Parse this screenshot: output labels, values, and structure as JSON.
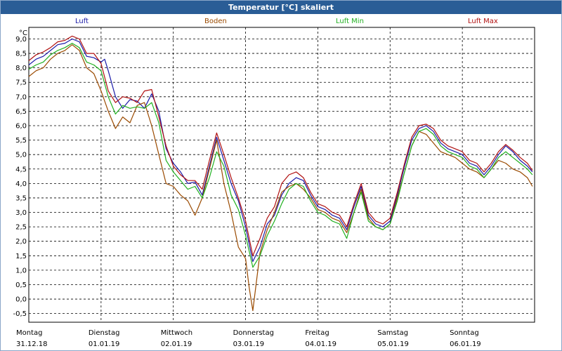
{
  "window": {
    "title": "Temperatur [°C] skaliert"
  },
  "chart_data": {
    "type": "line",
    "title": "Temperatur [°C] skaliert",
    "ylabel": "°C",
    "ylim": [
      -0.8,
      9.4
    ],
    "xlim": [
      0,
      7
    ],
    "grid": true,
    "legend_position": "top",
    "yticks": [
      9.0,
      8.5,
      8.0,
      7.5,
      7.0,
      6.5,
      6.0,
      5.5,
      5.0,
      4.5,
      4.0,
      3.5,
      3.0,
      2.5,
      2.0,
      1.5,
      1.0,
      0.5,
      0.0,
      -0.5
    ],
    "ytick_labels": [
      "9,0",
      "8,5",
      "8,0",
      "7,5",
      "7,0",
      "6,5",
      "6,0",
      "5,5",
      "5,0",
      "4,5",
      "4,0",
      "3,5",
      "3,0",
      "2,5",
      "2,0",
      "1,5",
      "1,0",
      "0,5",
      "0,0",
      "-0,5"
    ],
    "xticks": [
      {
        "day": "Montag",
        "date": "31.12.18"
      },
      {
        "day": "Dienstag",
        "date": "01.01.19"
      },
      {
        "day": "Mittwoch",
        "date": "02.01.19"
      },
      {
        "day": "Donnerstag",
        "date": "03.01.19"
      },
      {
        "day": "Freitag",
        "date": "04.01.19"
      },
      {
        "day": "Samstag",
        "date": "05.01.19"
      },
      {
        "day": "Sonntag",
        "date": "06.01.19"
      }
    ],
    "series": [
      {
        "name": "Luft",
        "color": "#1a1aa8",
        "x": [
          0,
          0.1,
          0.2,
          0.3,
          0.4,
          0.5,
          0.6,
          0.7,
          0.8,
          0.9,
          1.0,
          1.05,
          1.1,
          1.2,
          1.3,
          1.4,
          1.5,
          1.6,
          1.7,
          1.8,
          1.9,
          2.0,
          2.1,
          2.2,
          2.3,
          2.4,
          2.5,
          2.6,
          2.7,
          2.8,
          2.9,
          3.0,
          3.1,
          3.2,
          3.3,
          3.4,
          3.5,
          3.6,
          3.7,
          3.8,
          3.9,
          4.0,
          4.1,
          4.2,
          4.3,
          4.4,
          4.5,
          4.6,
          4.7,
          4.8,
          4.9,
          5.0,
          5.1,
          5.2,
          5.3,
          5.4,
          5.5,
          5.6,
          5.7,
          5.8,
          5.9,
          6.0,
          6.1,
          6.2,
          6.3,
          6.4,
          6.5,
          6.6,
          6.7,
          6.8,
          6.9,
          6.97
        ],
        "y": [
          8.1,
          8.3,
          8.4,
          8.6,
          8.8,
          8.85,
          9.0,
          8.9,
          8.4,
          8.35,
          8.2,
          8.3,
          7.9,
          7.0,
          6.6,
          6.9,
          6.85,
          6.6,
          7.1,
          6.5,
          5.2,
          4.7,
          4.4,
          4.0,
          4.05,
          3.6,
          4.6,
          5.6,
          4.8,
          4.0,
          3.4,
          2.5,
          1.3,
          1.8,
          2.6,
          2.9,
          3.6,
          4.0,
          4.2,
          4.1,
          3.6,
          3.2,
          3.1,
          2.9,
          2.8,
          2.4,
          3.2,
          3.9,
          2.9,
          2.6,
          2.5,
          2.7,
          3.6,
          4.6,
          5.5,
          5.9,
          6.0,
          5.8,
          5.4,
          5.2,
          5.1,
          5.0,
          4.7,
          4.6,
          4.3,
          4.6,
          5.0,
          5.3,
          5.1,
          4.8,
          4.6,
          4.4
        ]
      },
      {
        "name": "Boden",
        "color": "#9a4a00",
        "x": [
          0,
          0.1,
          0.2,
          0.3,
          0.4,
          0.5,
          0.6,
          0.7,
          0.8,
          0.9,
          1.0,
          1.1,
          1.2,
          1.3,
          1.4,
          1.5,
          1.6,
          1.7,
          1.8,
          1.9,
          2.0,
          2.1,
          2.2,
          2.3,
          2.4,
          2.5,
          2.6,
          2.7,
          2.8,
          2.9,
          3.0,
          3.05,
          3.1,
          3.2,
          3.3,
          3.4,
          3.5,
          3.6,
          3.7,
          3.8,
          3.9,
          4.0,
          4.1,
          4.2,
          4.3,
          4.4,
          4.5,
          4.6,
          4.7,
          4.8,
          4.9,
          5.0,
          5.1,
          5.2,
          5.3,
          5.4,
          5.5,
          5.6,
          5.7,
          5.8,
          5.9,
          6.0,
          6.1,
          6.2,
          6.3,
          6.4,
          6.5,
          6.6,
          6.7,
          6.8,
          6.9,
          6.97
        ],
        "y": [
          7.7,
          7.9,
          8.0,
          8.3,
          8.5,
          8.6,
          8.8,
          8.6,
          8.0,
          7.8,
          7.2,
          6.5,
          5.9,
          6.3,
          6.1,
          6.7,
          6.8,
          6.0,
          5.0,
          4.0,
          3.9,
          3.6,
          3.4,
          2.9,
          3.5,
          4.5,
          5.5,
          4.0,
          3.0,
          1.8,
          1.4,
          0.4,
          -0.4,
          1.6,
          2.4,
          3.0,
          3.7,
          3.9,
          4.0,
          3.8,
          3.5,
          3.1,
          3.0,
          2.8,
          2.7,
          2.3,
          3.0,
          3.8,
          2.8,
          2.5,
          2.4,
          2.6,
          3.5,
          4.4,
          5.3,
          5.8,
          5.7,
          5.4,
          5.1,
          5.0,
          4.9,
          4.7,
          4.5,
          4.4,
          4.2,
          4.5,
          4.8,
          4.7,
          4.5,
          4.4,
          4.2,
          3.9
        ]
      },
      {
        "name": "Luft Min",
        "color": "#20b020",
        "x": [
          0,
          0.1,
          0.2,
          0.3,
          0.4,
          0.5,
          0.6,
          0.7,
          0.8,
          0.9,
          1.0,
          1.1,
          1.2,
          1.3,
          1.4,
          1.5,
          1.6,
          1.7,
          1.8,
          1.9,
          2.0,
          2.1,
          2.2,
          2.3,
          2.4,
          2.5,
          2.6,
          2.7,
          2.8,
          2.9,
          3.0,
          3.1,
          3.2,
          3.3,
          3.4,
          3.5,
          3.6,
          3.7,
          3.8,
          3.9,
          4.0,
          4.1,
          4.2,
          4.3,
          4.4,
          4.5,
          4.6,
          4.7,
          4.8,
          4.9,
          5.0,
          5.1,
          5.2,
          5.3,
          5.4,
          5.5,
          5.6,
          5.7,
          5.8,
          5.9,
          6.0,
          6.1,
          6.2,
          6.3,
          6.4,
          6.5,
          6.6,
          6.7,
          6.8,
          6.9,
          6.97
        ],
        "y": [
          7.95,
          8.1,
          8.2,
          8.45,
          8.6,
          8.7,
          8.85,
          8.7,
          8.2,
          8.1,
          7.9,
          7.0,
          6.4,
          6.7,
          6.6,
          6.65,
          6.6,
          6.8,
          6.1,
          4.8,
          4.4,
          4.1,
          3.8,
          3.9,
          3.5,
          4.2,
          5.1,
          4.6,
          3.6,
          3.1,
          2.2,
          1.1,
          1.5,
          2.2,
          2.7,
          3.3,
          3.8,
          4.0,
          3.9,
          3.4,
          3.0,
          2.9,
          2.7,
          2.6,
          2.1,
          3.0,
          3.7,
          2.7,
          2.5,
          2.4,
          2.6,
          3.4,
          4.4,
          5.3,
          5.8,
          5.9,
          5.7,
          5.3,
          5.1,
          5.0,
          4.9,
          4.6,
          4.5,
          4.2,
          4.5,
          4.9,
          5.1,
          4.9,
          4.7,
          4.5,
          4.3
        ]
      },
      {
        "name": "Luft Max",
        "color": "#b01010",
        "x": [
          0,
          0.1,
          0.2,
          0.3,
          0.4,
          0.5,
          0.6,
          0.7,
          0.8,
          0.9,
          1.0,
          1.1,
          1.2,
          1.3,
          1.4,
          1.5,
          1.6,
          1.7,
          1.8,
          1.9,
          2.0,
          2.1,
          2.2,
          2.3,
          2.4,
          2.5,
          2.6,
          2.7,
          2.8,
          2.9,
          3.0,
          3.1,
          3.2,
          3.3,
          3.4,
          3.5,
          3.6,
          3.7,
          3.8,
          3.9,
          4.0,
          4.1,
          4.2,
          4.3,
          4.4,
          4.5,
          4.6,
          4.7,
          4.8,
          4.9,
          5.0,
          5.1,
          5.2,
          5.3,
          5.4,
          5.5,
          5.6,
          5.7,
          5.8,
          5.9,
          6.0,
          6.1,
          6.2,
          6.3,
          6.4,
          6.5,
          6.6,
          6.7,
          6.8,
          6.9,
          6.97
        ],
        "y": [
          8.25,
          8.45,
          8.55,
          8.7,
          8.9,
          8.95,
          9.1,
          9.0,
          8.5,
          8.5,
          8.15,
          7.2,
          6.8,
          7.0,
          6.95,
          6.8,
          7.2,
          7.25,
          6.3,
          5.3,
          4.6,
          4.3,
          4.1,
          4.1,
          3.8,
          4.8,
          5.75,
          5.0,
          4.2,
          3.5,
          2.7,
          1.5,
          2.1,
          2.8,
          3.2,
          4.0,
          4.3,
          4.4,
          4.2,
          3.7,
          3.3,
          3.2,
          3.0,
          2.9,
          2.5,
          3.3,
          4.0,
          3.0,
          2.7,
          2.6,
          2.8,
          3.7,
          4.7,
          5.6,
          6.0,
          6.05,
          5.9,
          5.5,
          5.3,
          5.2,
          5.1,
          4.8,
          4.7,
          4.4,
          4.7,
          5.1,
          5.35,
          5.15,
          4.9,
          4.7,
          4.45
        ]
      }
    ]
  }
}
